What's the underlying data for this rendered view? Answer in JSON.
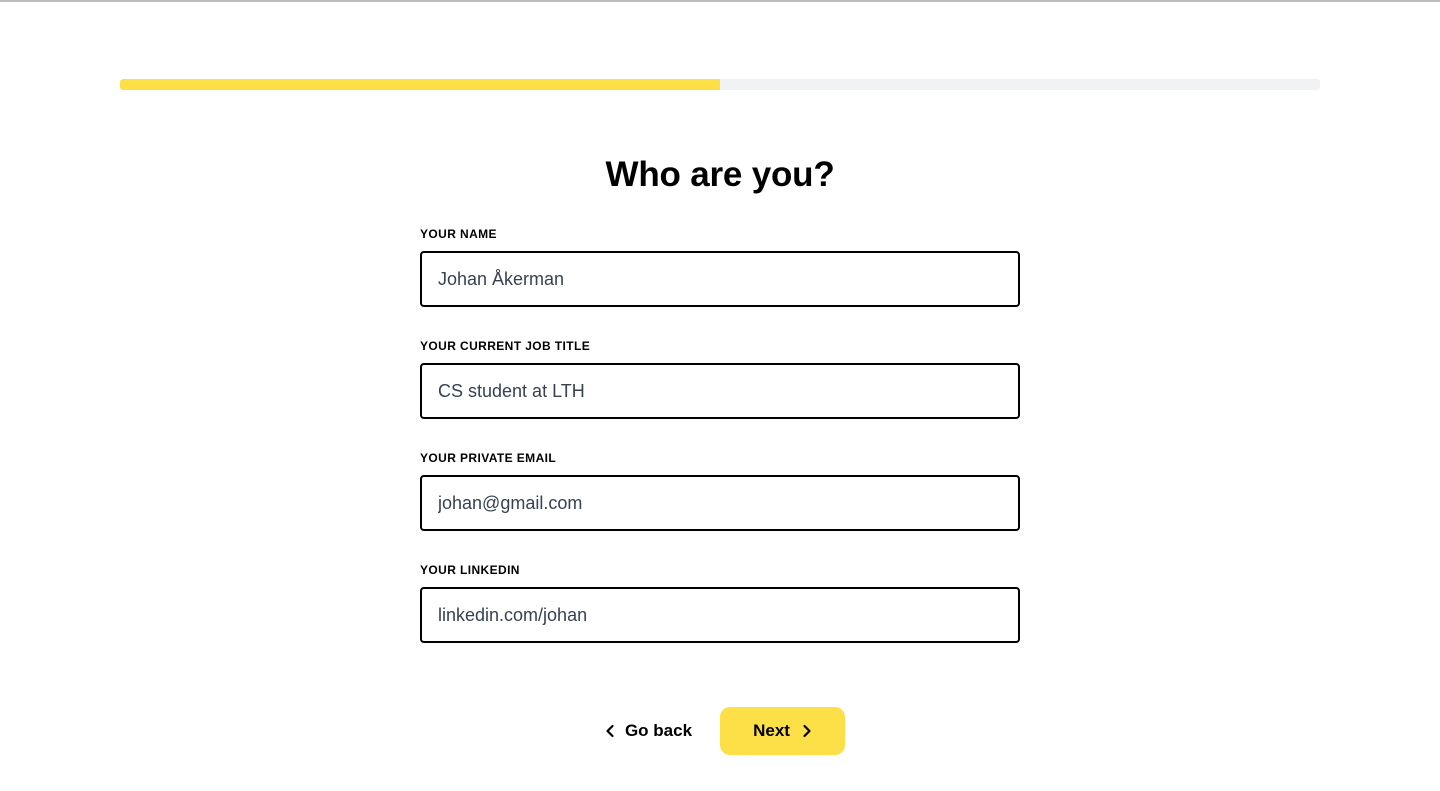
{
  "progress": {
    "fraction": 0.5,
    "fill_color": "#fde047",
    "track_color": "#f1f2f4"
  },
  "page": {
    "title": "Who are you?"
  },
  "form": {
    "fields": [
      {
        "label": "YOUR NAME",
        "value": "Johan Åkerman"
      },
      {
        "label": "YOUR CURRENT JOB TITLE",
        "value": "CS student at LTH"
      },
      {
        "label": "YOUR PRIVATE EMAIL",
        "value": "johan@gmail.com"
      },
      {
        "label": "YOUR LINKEDIN",
        "value": "linkedin.com/johan"
      }
    ]
  },
  "actions": {
    "back_label": "Go back",
    "back_icon": "chevron-left-icon",
    "next_label": "Next",
    "next_icon": "chevron-right-icon",
    "accent_color": "#fde047"
  }
}
